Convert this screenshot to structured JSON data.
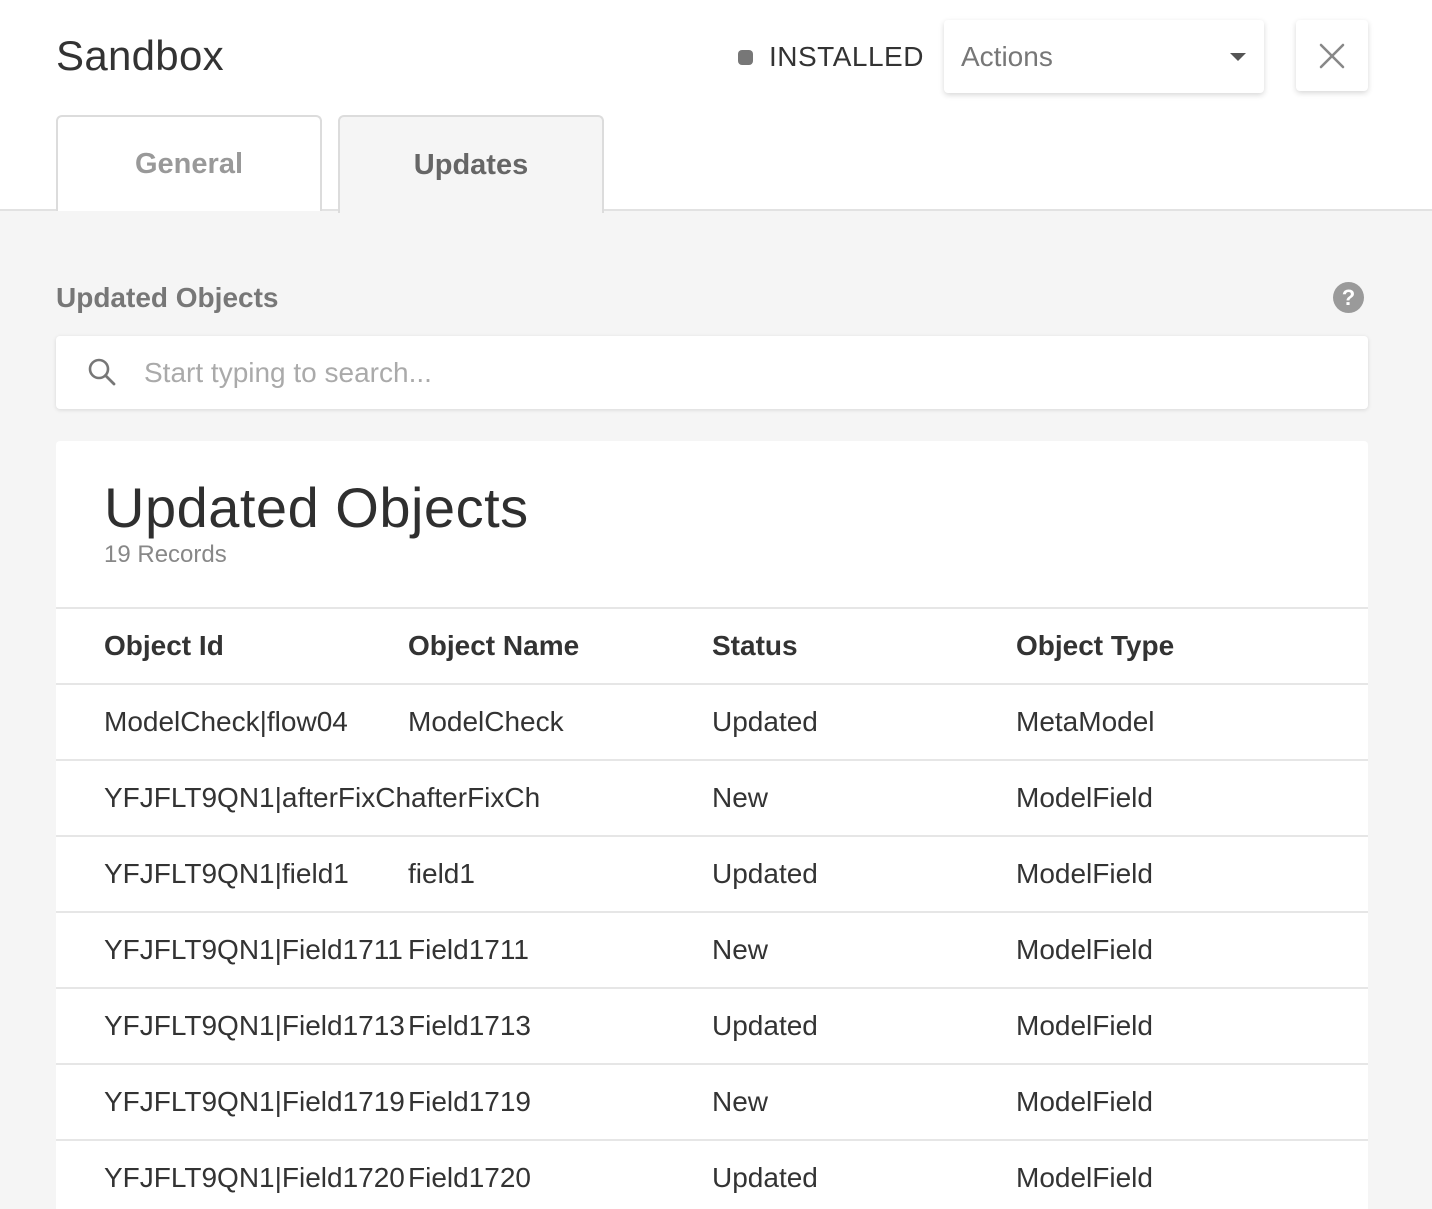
{
  "header": {
    "title": "Sandbox",
    "status": "INSTALLED",
    "actions_label": "Actions"
  },
  "tabs": [
    {
      "label": "General"
    },
    {
      "label": "Updates"
    }
  ],
  "section": {
    "label": "Updated Objects",
    "help_icon": "?"
  },
  "search": {
    "placeholder": "Start typing to search...",
    "value": ""
  },
  "table": {
    "title": "Updated Objects",
    "records": "19 Records",
    "columns": [
      "Object Id",
      "Object Name",
      "Status",
      "Object Type"
    ],
    "rows": [
      {
        "id": "ModelCheck|flow04",
        "name": "ModelCheck",
        "status": "Updated",
        "type": "MetaModel"
      },
      {
        "id": "YFJFLT9QN1|afterFixChafterFixCh",
        "name": "",
        "status": "New",
        "type": "ModelField"
      },
      {
        "id": "YFJFLT9QN1|field1",
        "name": "field1",
        "status": "Updated",
        "type": "ModelField"
      },
      {
        "id": "YFJFLT9QN1|Field1711",
        "name": "Field1711",
        "status": "New",
        "type": "ModelField"
      },
      {
        "id": "YFJFLT9QN1|Field1713",
        "name": "Field1713",
        "status": "Updated",
        "type": "ModelField"
      },
      {
        "id": "YFJFLT9QN1|Field1719",
        "name": "Field1719",
        "status": "New",
        "type": "ModelField"
      },
      {
        "id": "YFJFLT9QN1|Field1720",
        "name": "Field1720",
        "status": "Updated",
        "type": "ModelField"
      }
    ]
  }
}
